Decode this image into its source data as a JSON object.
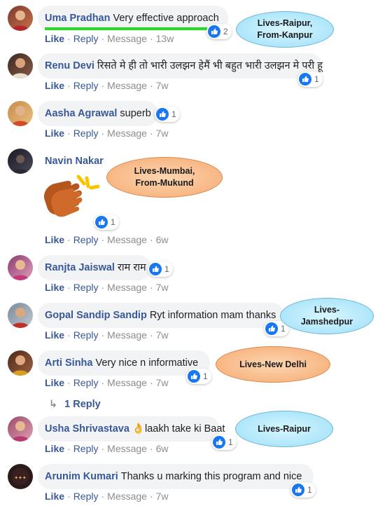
{
  "comments": [
    {
      "author": "Uma Pradhan",
      "text": "Very effective approach",
      "like": "Like",
      "reply": "Reply",
      "message": "Message",
      "time": "13w",
      "reactions": "2"
    },
    {
      "author": "Renu Devi",
      "text": "रिसते मे ही तो भारी उलझन हेमैं भी बहुत भारी उलझन मे परी हू",
      "like": "Like",
      "reply": "Reply",
      "message": "Message",
      "time": "7w",
      "reactions": "1"
    },
    {
      "author": "Aasha Agrawal",
      "text": "superb",
      "like": "Like",
      "reply": "Reply",
      "message": "Message",
      "time": "7w",
      "reactions": "1"
    },
    {
      "author": "Navin Nakar",
      "text": "",
      "like": "Like",
      "reply": "Reply",
      "message": "Message",
      "time": "6w",
      "reactions": "1"
    },
    {
      "author": "Ranjta Jaiswal",
      "text": "राम राम",
      "like": "Like",
      "reply": "Reply",
      "message": "Message",
      "time": "7w",
      "reactions": "1"
    },
    {
      "author": "Gopal Sandip Sandip",
      "text": "Ryt information mam thanks",
      "like": "Like",
      "reply": "Reply",
      "message": "Message",
      "time": "7w",
      "reactions": "1"
    },
    {
      "author": "Arti Sinha",
      "text": "Very nice n informative",
      "like": "Like",
      "reply": "Reply",
      "message": "Message",
      "time": "7w",
      "reactions": "1"
    },
    {
      "author": "Usha Shrivastava",
      "text": "laakh take ki Baat",
      "emoji": "👌",
      "like": "Like",
      "reply": "Reply",
      "message": "Message",
      "time": "6w",
      "reactions": "1"
    },
    {
      "author": "Arunim Kumari",
      "text": "Thanks u marking this program and nice",
      "like": "Like",
      "reply": "Reply",
      "message": "Message",
      "time": "7w",
      "reactions": "1"
    }
  ],
  "replies_link": "1 Reply",
  "callouts": [
    {
      "line1": "Lives-Raipur,",
      "line2": "From-Kanpur"
    },
    {
      "line1": "Lives-Mumbai,",
      "line2": "From-Mukund"
    },
    {
      "line1": "Lives-",
      "line2": "Jamshedpur"
    },
    {
      "line1": "Lives-New Delhi",
      "line2": ""
    },
    {
      "line1": "Lives-Raipur",
      "line2": ""
    }
  ],
  "icons": {
    "reaction": "like-thumb-icon",
    "reply_arrow": "reply-arrow-icon",
    "sticker": "clapping-hands-icon"
  },
  "colors": {
    "link": "#385898",
    "bubble": "#f2f3f5",
    "like_blue": "#1877f2",
    "highlight": "#22dd22"
  }
}
